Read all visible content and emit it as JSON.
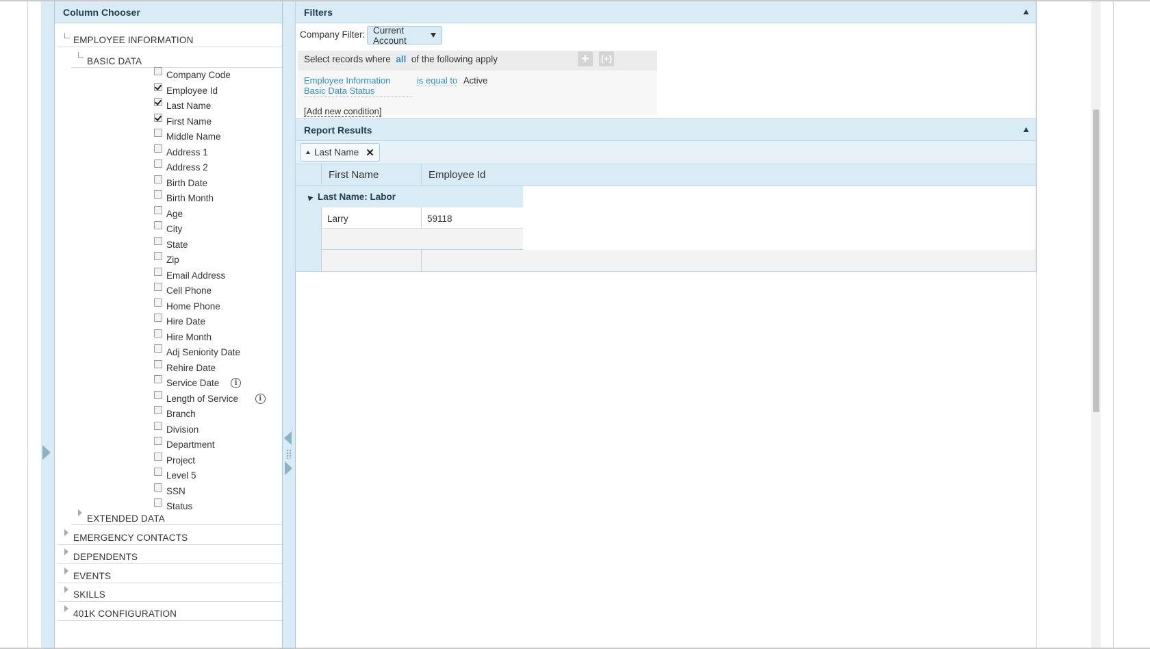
{
  "column_chooser": {
    "title": "Column Chooser",
    "sections": [
      {
        "label": "EMPLOYEE INFORMATION",
        "expanded": true
      },
      {
        "label": "EMERGENCY CONTACTS",
        "expanded": false
      },
      {
        "label": "DEPENDENTS",
        "expanded": false
      },
      {
        "label": "EVENTS",
        "expanded": false
      },
      {
        "label": "SKILLS",
        "expanded": false
      },
      {
        "label": "401K CONFIGURATION",
        "expanded": false
      }
    ],
    "subsections": [
      {
        "label": "BASIC DATA",
        "expanded": true
      },
      {
        "label": "EXTENDED DATA",
        "expanded": false
      }
    ],
    "fields": [
      {
        "label": "Company Code",
        "checked": false
      },
      {
        "label": "Employee Id",
        "checked": true
      },
      {
        "label": "Last Name",
        "checked": true
      },
      {
        "label": "First Name",
        "checked": true
      },
      {
        "label": "Middle Name",
        "checked": false
      },
      {
        "label": "Address 1",
        "checked": false
      },
      {
        "label": "Address 2",
        "checked": false
      },
      {
        "label": "Birth Date",
        "checked": false
      },
      {
        "label": "Birth Month",
        "checked": false
      },
      {
        "label": "Age",
        "checked": false
      },
      {
        "label": "City",
        "checked": false
      },
      {
        "label": "State",
        "checked": false
      },
      {
        "label": "Zip",
        "checked": false
      },
      {
        "label": "Email Address",
        "checked": false
      },
      {
        "label": "Cell Phone",
        "checked": false
      },
      {
        "label": "Home Phone",
        "checked": false
      },
      {
        "label": "Hire Date",
        "checked": false
      },
      {
        "label": "Hire Month",
        "checked": false
      },
      {
        "label": "Adj Seniority Date",
        "checked": false
      },
      {
        "label": "Rehire Date",
        "checked": false
      },
      {
        "label": "Service Date",
        "checked": false,
        "info": true
      },
      {
        "label": "Length of Service",
        "checked": false,
        "info": true
      },
      {
        "label": "Branch",
        "checked": false
      },
      {
        "label": "Division",
        "checked": false
      },
      {
        "label": "Department",
        "checked": false
      },
      {
        "label": "Project",
        "checked": false
      },
      {
        "label": "Level 5",
        "checked": false
      },
      {
        "label": "SSN",
        "checked": false
      },
      {
        "label": "Status",
        "checked": false
      }
    ]
  },
  "filters": {
    "title": "Filters",
    "company_filter_label": "Company Filter:",
    "company_filter_value": "Current Account",
    "select_prefix": "Select records where",
    "select_match": "all",
    "select_suffix": "of the following apply",
    "plus_icon": "+",
    "group_icon": "(+)",
    "condition": {
      "field": "Employee Information Basic Data Status",
      "operator": "is equal to",
      "value": "Active"
    },
    "add_condition": "[Add new condition]"
  },
  "results": {
    "title": "Report Results",
    "group_chip": "Last Name",
    "chip_close": "✕",
    "columns": [
      "First Name",
      "Employee Id"
    ],
    "group_label": "Last Name: Labor",
    "rows": [
      {
        "first_name": "Larry",
        "employee_id": "59118"
      }
    ]
  },
  "colors": {
    "panel_header_bg": "#d9ebf5",
    "border": "#b8d6e6",
    "link": "#2e8fca"
  }
}
